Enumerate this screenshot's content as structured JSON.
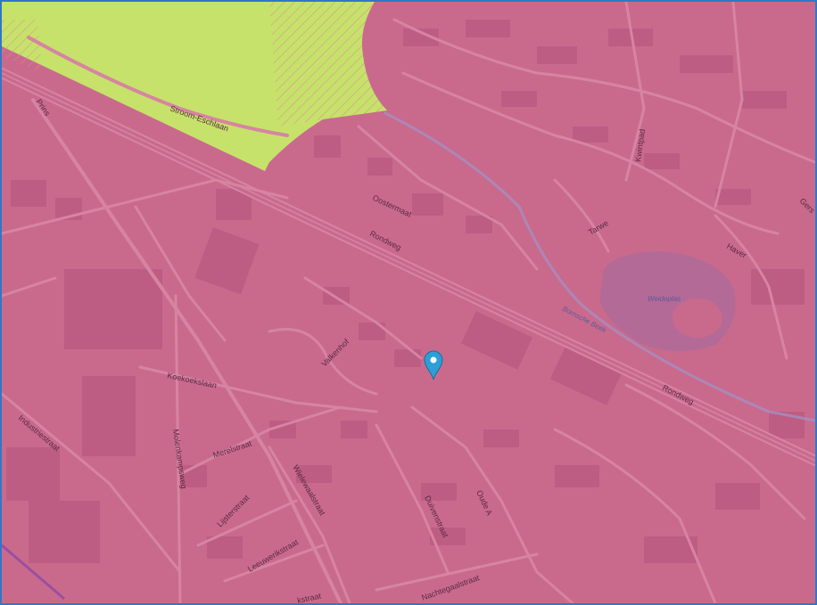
{
  "map": {
    "overlay_color": "#c96a8d",
    "green_zone_color": "#c6e26a",
    "marker_color": "#2b9fd6",
    "streets": {
      "stroom_eschlaan": "Stroom-Eschlaan",
      "prins": "Prins",
      "oostermaat": "Oostermaat",
      "rondweg_1": "Rondweg",
      "rondweg_2": "Rondweg",
      "kwintpad": "Kwintpad",
      "tarwe": "Tarwe",
      "haver": "Haver",
      "gerst": "Gers",
      "valkenhof": "Valkenhof",
      "koekoekslaan": "Koekoekslaan",
      "industriestraat": "Industriestraat",
      "molenkampsweg": "Molenkampsweg",
      "merelstraat": "Merelstraat",
      "wielewaalstraat": "Wielewaalstraat",
      "duivenstraat": "Duivenstraat",
      "oude_a": "Oude A",
      "lijsterstraat": "Lijsterstraat",
      "leeuwerikstraat": "Leeuwerikstraat",
      "ekstraat": "kstraat",
      "nachtegaalstraat": "Nachtegaalstraat"
    },
    "water": {
      "bornsche_beek": "Bornsche Beek",
      "weideplas": "Weideplas"
    }
  }
}
